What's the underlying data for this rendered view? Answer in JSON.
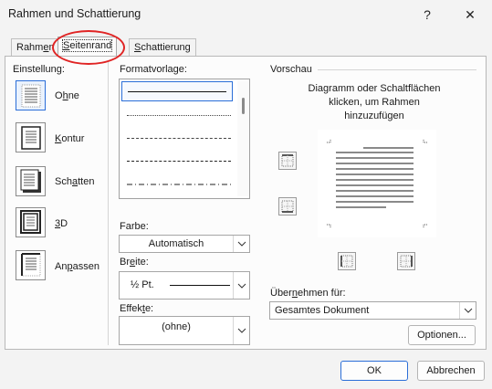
{
  "window": {
    "title": "Rahmen und Schattierung",
    "help_label": "?",
    "close_label": "✕"
  },
  "tabs": [
    {
      "label_pre": "Rahm",
      "label_ul": "e",
      "label_post": "n"
    },
    {
      "label_pre": "",
      "label_ul": "S",
      "label_post": "eitenrand"
    },
    {
      "label_pre": "",
      "label_ul": "S",
      "label_post": "chattierung"
    }
  ],
  "settings": {
    "heading": "Einstellung:",
    "items": [
      {
        "pre": "O",
        "ul": "h",
        "post": "ne"
      },
      {
        "pre": "",
        "ul": "K",
        "post": "ontur"
      },
      {
        "pre": "Sch",
        "ul": "a",
        "post": "tten"
      },
      {
        "pre": "",
        "ul": "3",
        "post": "D"
      },
      {
        "pre": "An",
        "ul": "p",
        "post": "assen"
      }
    ]
  },
  "style": {
    "heading": "Formatvorlage:",
    "color_label_pre": "Farbe",
    "color_label_post": ":",
    "color_value": "Automatisch",
    "width_label_pre": "Br",
    "width_label_ul": "e",
    "width_label_post": "ite:",
    "width_value": "½ Pt.",
    "effects_label_pre": "Effek",
    "effects_label_ul": "t",
    "effects_label_post": "e:",
    "effects_value": "(ohne)"
  },
  "preview": {
    "heading": "Vorschau",
    "hint": "Diagramm oder Schaltflächen klicken, um Rahmen hinzuzufügen",
    "apply_label_pre": "Über",
    "apply_label_ul": "n",
    "apply_label_post": "ehmen für:",
    "apply_value": "Gesamtes Dokument",
    "options_label": "Optionen..."
  },
  "footer": {
    "ok_label": "OK",
    "cancel_label": "Abbrechen"
  },
  "colors": {
    "accent": "#2b6ed8",
    "highlight_ring": "#e02424"
  }
}
